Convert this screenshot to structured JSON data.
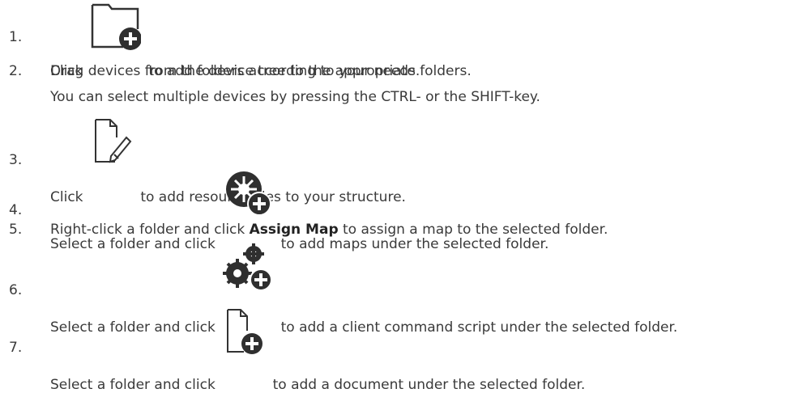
{
  "steps": [
    {
      "num": "1.",
      "text_before": "Click",
      "text_after": "to add folders according to your needs.",
      "icon": "new-folder-icon"
    },
    {
      "num": "2.",
      "text": "Drag devices from the device tree to the appropriate folders.",
      "subtext": "You can select multiple devices by pressing the CTRL- or the SHIFT-key."
    },
    {
      "num": "3.",
      "text_before": "Click",
      "text_after": "to add resource files to your structure.",
      "icon": "edit-file-icon"
    },
    {
      "num": "4.",
      "text_before": "Select a folder and click",
      "text_after": "to add maps under the selected folder.",
      "icon": "add-map-icon"
    },
    {
      "num": "5.",
      "text_before": "Right-click a folder and click",
      "bold": "Assign Map",
      "text_after": "to assign a map to the selected folder."
    },
    {
      "num": "6.",
      "text_before": "Select a folder and click",
      "text_after": "to add a client command script under the selected folder.",
      "icon": "add-script-icon"
    },
    {
      "num": "7.",
      "text_before": "Select a folder and click",
      "text_after": "to add a document under the selected folder.",
      "icon": "add-document-icon"
    }
  ]
}
